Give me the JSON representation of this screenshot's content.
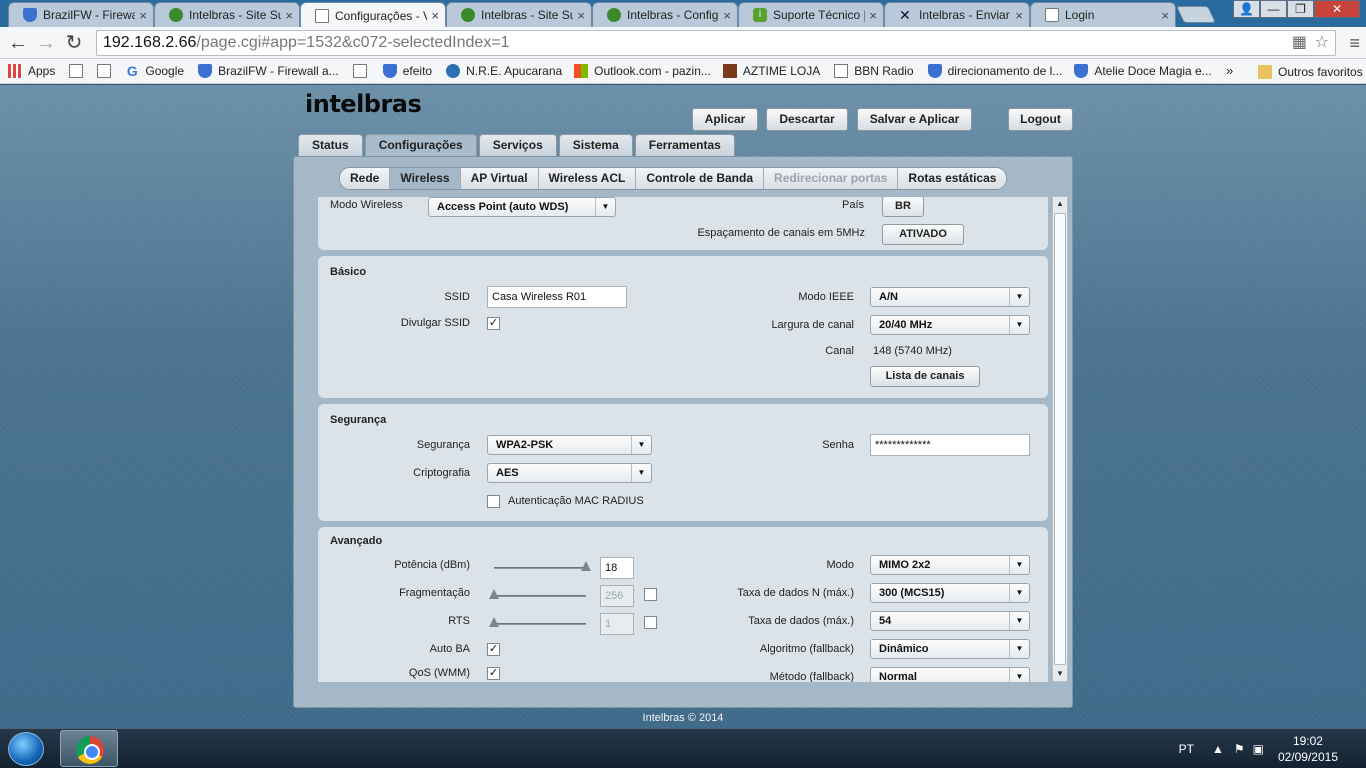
{
  "browser": {
    "tabs": [
      {
        "title": "BrazilFW - Firewa",
        "icon": "shield-icon"
      },
      {
        "title": "Intelbras - Site Su",
        "icon": "leaf-icon"
      },
      {
        "title": "Configurações - V",
        "icon": "page-icon",
        "active": true
      },
      {
        "title": "Intelbras - Site Su",
        "icon": "leaf-icon"
      },
      {
        "title": "Intelbras - Config",
        "icon": "leaf-icon"
      },
      {
        "title": "Suporte Técnico |",
        "icon": "green-i-icon"
      },
      {
        "title": "Intelbras - Enviar",
        "icon": "x-logo-icon"
      },
      {
        "title": "Login",
        "icon": "page-icon"
      }
    ],
    "tab_close": "×",
    "window_controls": {
      "user": "👤",
      "minimize": "—",
      "maximize": "❐",
      "close": "✕"
    },
    "url_host": "192.168.2.66",
    "url_path": "/page.cgi#app=1532&c072-selectedIndex=1",
    "nav": {
      "back": "←",
      "forward": "→",
      "reload": "↻",
      "star": "☆",
      "menu": "≡"
    },
    "bookmarks": [
      {
        "label": "Apps",
        "icon": "apps-icon"
      },
      {
        "label": "",
        "icon": "page-icon"
      },
      {
        "label": "",
        "icon": "page-icon"
      },
      {
        "label": "Google",
        "icon": "google-icon"
      },
      {
        "label": "BrazilFW - Firewall a...",
        "icon": "shield-icon"
      },
      {
        "label": "",
        "icon": "page-icon"
      },
      {
        "label": "efeito",
        "icon": "shield-icon"
      },
      {
        "label": "N.R.E. Apucarana",
        "icon": "globe-icon"
      },
      {
        "label": "Outlook.com - pazin...",
        "icon": "ms-icon"
      },
      {
        "label": "AZTIME LOJA",
        "icon": "rss-icon"
      },
      {
        "label": "BBN Radio",
        "icon": "page-icon"
      },
      {
        "label": "direcionamento de l...",
        "icon": "shield-icon"
      },
      {
        "label": "Atelie Doce Magia e...",
        "icon": "shield-icon"
      }
    ],
    "bookmarks_more": "»",
    "bookmarks_other": "Outros favoritos"
  },
  "app": {
    "logo": "intelbras",
    "header_buttons": {
      "apply": "Aplicar",
      "discard": "Descartar",
      "save_apply": "Salvar e Aplicar",
      "logout": "Logout"
    },
    "main_tabs": [
      "Status",
      "Configurações",
      "Serviços",
      "Sistema",
      "Ferramentas"
    ],
    "sub_tabs": [
      "Rede",
      "Wireless",
      "AP Virtual",
      "Wireless ACL",
      "Controle de Banda",
      "Redirecionar portas",
      "Rotas estáticas"
    ],
    "top": {
      "modo_wireless_label": "Modo Wireless",
      "modo_wireless_value": "Access Point (auto WDS)",
      "pais_label": "País",
      "pais_value": "BR",
      "espacamento_label": "Espaçamento de canais em 5MHz",
      "espacamento_value": "ATIVADO"
    },
    "basico": {
      "title": "Básico",
      "ssid_label": "SSID",
      "ssid_value": "Casa Wireless R01",
      "divulgar_label": "Divulgar SSID",
      "divulgar_checked": true,
      "modo_ieee_label": "Modo IEEE",
      "modo_ieee_value": "A/N",
      "largura_label": "Largura de canal",
      "largura_value": "20/40 MHz",
      "canal_label": "Canal",
      "canal_value": "148 (5740 MHz)",
      "lista_canais": "Lista de canais"
    },
    "seguranca": {
      "title": "Segurança",
      "seg_label": "Segurança",
      "seg_value": "WPA2-PSK",
      "cripto_label": "Criptografia",
      "cripto_value": "AES",
      "mac_radius_label": "Autenticação MAC RADIUS",
      "mac_radius_checked": false,
      "senha_label": "Senha",
      "senha_value": "*************"
    },
    "avancado": {
      "title": "Avançado",
      "potencia_label": "Potência (dBm)",
      "potencia_value": "18",
      "potencia_level": 1.0,
      "frag_label": "Fragmentação",
      "frag_value": "256",
      "frag_level": 0.0,
      "frag_checked": false,
      "rts_label": "RTS",
      "rts_value": "1",
      "rts_level": 0.0,
      "rts_checked": false,
      "autoba_label": "Auto BA",
      "autoba_checked": true,
      "qos_label": "QoS (WMM)",
      "qos_checked": true,
      "modo_label": "Modo",
      "modo_value": "MIMO 2x2",
      "taxa_n_label": "Taxa de dados N (máx.)",
      "taxa_n_value": "300 (MCS15)",
      "taxa_label": "Taxa de dados (máx.)",
      "taxa_value": "54",
      "algoritmo_label": "Algoritmo (fallback)",
      "algoritmo_value": "Dinâmico",
      "metodo_label": "Método (fallback)",
      "metodo_value": "Normal"
    },
    "footer": "Intelbras © 2014"
  },
  "taskbar": {
    "lang": "PT",
    "time": "19:02",
    "date": "02/09/2015"
  }
}
